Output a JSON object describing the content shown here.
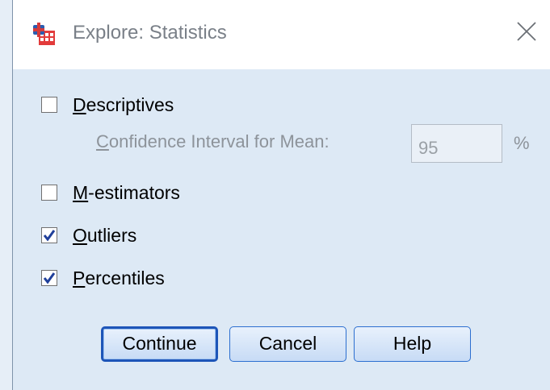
{
  "window": {
    "title": "Explore: Statistics",
    "app_icon": "spss-app-icon",
    "close_glyph": "✕"
  },
  "options": {
    "descriptives": {
      "mnemonic": "D",
      "rest": "escriptives",
      "checked": false
    },
    "confidence_interval": {
      "label_mnemonic": "C",
      "label_rest": "onfidence Interval for Mean:",
      "value": "95",
      "unit": "%"
    },
    "m_estimators": {
      "mnemonic": "M",
      "rest": "-estimators",
      "checked": false
    },
    "outliers": {
      "mnemonic": "O",
      "rest": "utliers",
      "checked": true
    },
    "percentiles": {
      "mnemonic": "P",
      "rest": "ercentiles",
      "checked": true
    }
  },
  "buttons": {
    "continue": "Continue",
    "cancel": "Cancel",
    "help": "Help"
  },
  "colors": {
    "dialog_bg": "#dde9f5",
    "titlebar_bg": "#ffffff",
    "button_border": "#2c6fd0",
    "check_color": "#1f3f9a"
  }
}
